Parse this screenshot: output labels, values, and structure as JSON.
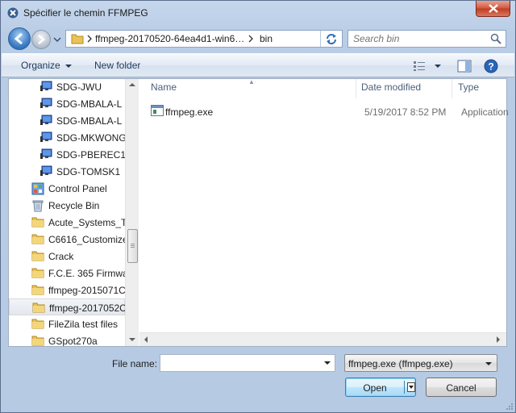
{
  "window": {
    "title": "Spécifier le chemin FFMPEG"
  },
  "address": {
    "segments": [
      "ffmpeg-20170520-64ea4d1-win6…",
      "bin"
    ]
  },
  "search": {
    "placeholder": "Search bin"
  },
  "toolbar": {
    "organize_label": "Organize",
    "new_folder_label": "New folder"
  },
  "nav": {
    "items": [
      {
        "label": "SDG-JWU",
        "icon": "computer-icon"
      },
      {
        "label": "SDG-MBALA-L",
        "icon": "computer-icon"
      },
      {
        "label": "SDG-MBALA-L",
        "icon": "computer-icon"
      },
      {
        "label": "SDG-MKWONG",
        "icon": "computer-icon"
      },
      {
        "label": "SDG-PBEREC1-",
        "icon": "computer-icon"
      },
      {
        "label": "SDG-TOMSK1",
        "icon": "computer-icon"
      },
      {
        "label": "Control Panel",
        "icon": "control-panel-icon"
      },
      {
        "label": "Recycle Bin",
        "icon": "recycle-bin-icon"
      },
      {
        "label": "Acute_Systems_T",
        "icon": "folder-icon"
      },
      {
        "label": "C6616_Customize",
        "icon": "folder-icon"
      },
      {
        "label": "Crack",
        "icon": "folder-icon"
      },
      {
        "label": "F.C.E. 365 Firmwa",
        "icon": "folder-icon"
      },
      {
        "label": "ffmpeg-2015071C",
        "icon": "folder-icon"
      },
      {
        "label": "ffmpeg-2017052C",
        "icon": "folder-icon",
        "selected": true
      },
      {
        "label": "FileZila test files",
        "icon": "folder-icon"
      },
      {
        "label": "GSpot270a",
        "icon": "folder-icon"
      }
    ]
  },
  "files": {
    "columns": {
      "name": "Name",
      "date": "Date modified",
      "type": "Type"
    },
    "rows": [
      {
        "name": "ffmpeg.exe",
        "date": "5/19/2017 8:52 PM",
        "type": "Application",
        "icon": "exe-icon"
      }
    ]
  },
  "bottom": {
    "filename_label": "File name:",
    "filename_value": "",
    "filter_value": "ffmpeg.exe (ffmpeg.exe)",
    "open_label": "Open",
    "cancel_label": "Cancel"
  },
  "colors": {
    "frame": "#b9cde6",
    "selection": "#e3e7ee",
    "accent": "#3c7fb1"
  }
}
